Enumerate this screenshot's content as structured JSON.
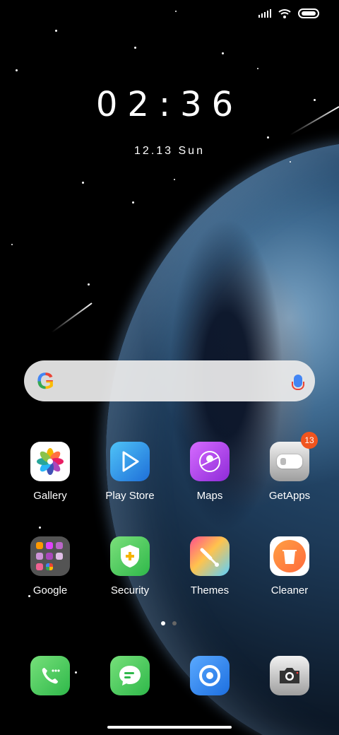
{
  "status_bar": {
    "icons": [
      "signal-icon",
      "wifi-icon",
      "battery-icon"
    ]
  },
  "lockscreen": {
    "time": "02:36",
    "date": "12.13 Sun"
  },
  "search_bar": {
    "logo_letter": "G",
    "icons": [
      "google-logo",
      "mic-icon"
    ]
  },
  "apps": {
    "row1": [
      {
        "label": "Gallery",
        "icon": "gallery-icon"
      },
      {
        "label": "Play Store",
        "icon": "play-store-icon"
      },
      {
        "label": "Maps",
        "icon": "maps-icon"
      },
      {
        "label": "GetApps",
        "icon": "getapps-icon",
        "badge": "13"
      }
    ],
    "row2": [
      {
        "label": "Google",
        "icon": "google-folder-icon"
      },
      {
        "label": "Security",
        "icon": "security-icon"
      },
      {
        "label": "Themes",
        "icon": "themes-icon"
      },
      {
        "label": "Cleaner",
        "icon": "cleaner-icon"
      }
    ]
  },
  "dock": [
    {
      "icon": "phone-icon"
    },
    {
      "icon": "messages-icon"
    },
    {
      "icon": "browser-icon"
    },
    {
      "icon": "camera-icon"
    }
  ],
  "page_indicator": {
    "pages": 2,
    "current": 1
  },
  "colors": {
    "badge": "#f0541e",
    "background": "#000000"
  }
}
